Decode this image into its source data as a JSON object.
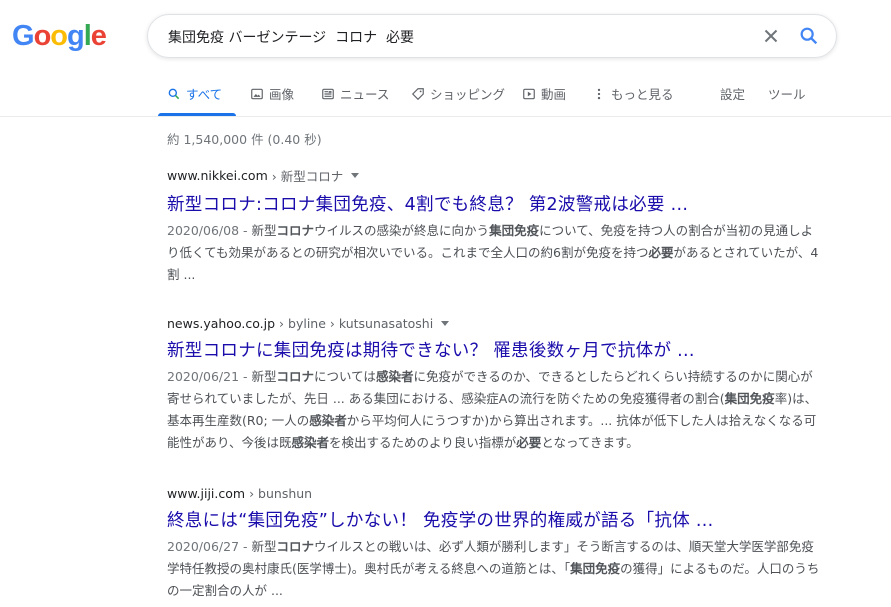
{
  "logo": [
    "G",
    "o",
    "o",
    "g",
    "l",
    "e"
  ],
  "search": {
    "query": "集団免疫 バーゼンテージ  コロナ  必要"
  },
  "tabs": {
    "all": "すべて",
    "images": "画像",
    "news": "ニュース",
    "shopping": "ショッピング",
    "videos": "動画",
    "more": "もっと見る",
    "settings": "設定",
    "tools": "ツール"
  },
  "stats": "約 1,540,000 件  (0.40 秒)",
  "results": [
    {
      "domain": "www.nikkei.com",
      "path": "› 新型コロナ",
      "title": "新型コロナ:コロナ集団免疫、4割でも終息？ 第2波警戒は必要 ...",
      "date": "2020/06/08 - ",
      "snippet_parts": [
        "新型",
        "コロナ",
        "ウイルスの感染が終息に向かう",
        "集団免疫",
        "について、免疫を持つ人の割合が当初の見通しより低くても効果があるとの研究が相次いでいる。これまで全人口の約6割が免疫を持つ",
        "必要",
        "があるとされていたが、4割 ..."
      ]
    },
    {
      "domain": "news.yahoo.co.jp",
      "path": "› byline › kutsunasatoshi",
      "title": "新型コロナに集団免疫は期待できない？ 罹患後数ヶ月で抗体が ...",
      "date": "2020/06/21 - ",
      "snippet_parts": [
        "新型",
        "コロナ",
        "については",
        "感染者",
        "に免疫ができるのか、できるとしたらどれくらい持続するのかに関心が寄せられていましたが、先日 ... ある集団における、感染症Aの流行を防ぐための免疫獲得者の割合(",
        "集団免疫",
        "率)は、基本再生産数(R0; 一人の",
        "感染者",
        "から平均何人にうつすか)から算出されます。... 抗体が低下した人は拾えなくなる可能性があり、今後は既",
        "感染者",
        "を検出するためのより良い指標が",
        "必要",
        "となってきます。"
      ]
    },
    {
      "domain": "www.jiji.com",
      "path": "› bunshun",
      "title": "終息には“集団免疫”しかない！ 免疫学の世界的権威が語る「抗体 ...",
      "date": "2020/06/27 - ",
      "snippet_parts": [
        "新型",
        "コロナ",
        "ウイルスとの戦いは、必ず人類が勝利します」そう断言するのは、順天堂大学医学部免疫学特任教授の奥村康氏(医学博士)。奥村氏が考える終息への道筋とは、「",
        "集団免疫",
        "の獲得」によるものだ。人口のうちの一定割合の人が ..."
      ]
    }
  ]
}
